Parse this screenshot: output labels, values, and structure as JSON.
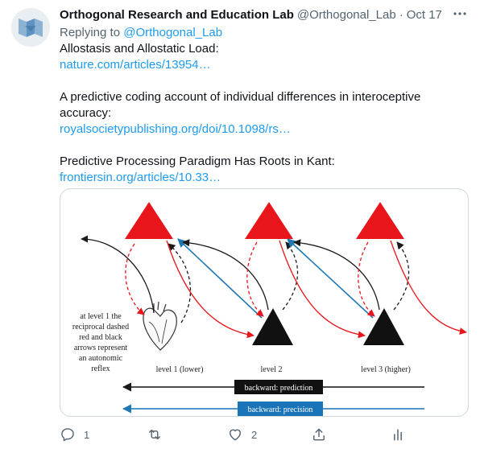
{
  "tweet": {
    "author_name": "Orthogonal Research and Education Lab",
    "author_handle": "@Orthogonal_Lab",
    "separator": "·",
    "date": "Oct 17",
    "replying_to_prefix": "Replying to",
    "replying_to_handle": "@Orthogonal_Lab",
    "paragraphs": [
      {
        "text": "Allostasis and Allostatic Load:",
        "link": "nature.com/articles/13954…"
      },
      {
        "text": "A predictive coding account of individual differences in interoceptive accuracy:",
        "link": "royalsocietypublishing.org/doi/10.1098/rs…"
      },
      {
        "text": "Predictive Processing Paradigm Has Roots in Kant:",
        "link": "frontiersin.org/articles/10.33…"
      }
    ]
  },
  "figure": {
    "annotation_lines": [
      "at level 1 the",
      "reciprocal dashed",
      "red and black",
      "arrows represent",
      "an autonomic",
      "reflex"
    ],
    "level1_label": "level 1 (lower)",
    "level2_label": "level 2",
    "level3_label": "level 3 (higher)",
    "backward_prediction": "backward: prediction",
    "backward_precision": "backward: precision"
  },
  "actions": {
    "reply_count": "1",
    "retweet_count": "",
    "like_count": "2"
  },
  "colors": {
    "link": "#1d9bf0",
    "secondary_text": "#536471",
    "triangle_red": "#e8161b",
    "arrow_blue": "#1f78b4",
    "precision_bar": "#1a74b8",
    "prediction_bar": "#111111"
  }
}
